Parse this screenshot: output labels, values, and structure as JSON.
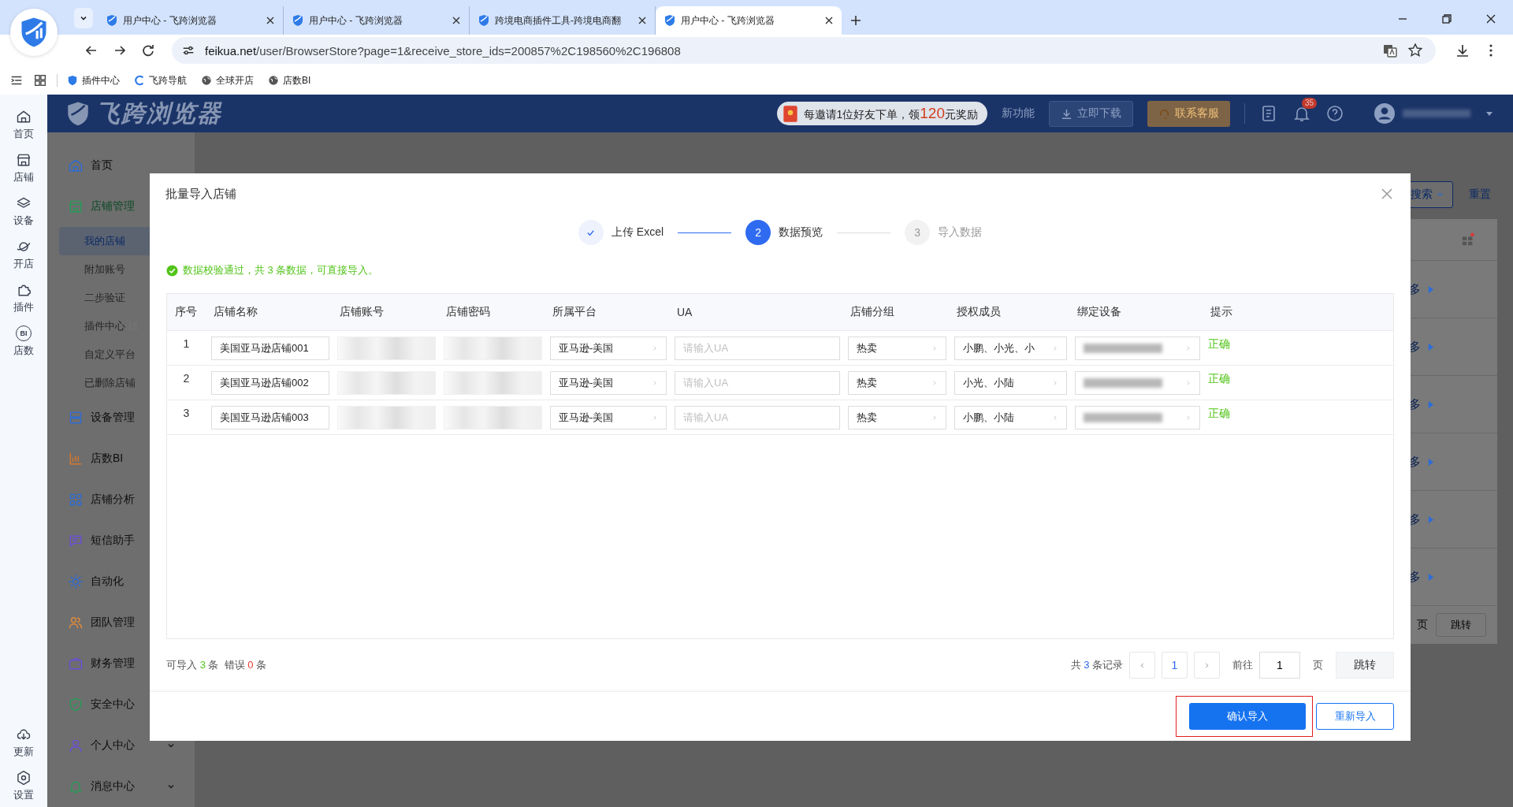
{
  "browser": {
    "tabs": [
      {
        "title": "用户中心 - 飞跨浏览器",
        "selected": false
      },
      {
        "title": "用户中心 - 飞跨浏览器",
        "selected": false
      },
      {
        "title": "跨境电商插件工具-跨境电商翻",
        "selected": false
      },
      {
        "title": "用户中心 - 飞跨浏览器",
        "selected": true
      }
    ],
    "url_host": "feikua.net",
    "url_path": "/user/BrowserStore?page=1&receive_store_ids=200857%2C198560%2C196808",
    "bookmarks": [
      "插件中心",
      "飞跨导航",
      "全球开店",
      "店数BI"
    ]
  },
  "rail": {
    "items": [
      {
        "label": "首页"
      },
      {
        "label": "店铺"
      },
      {
        "label": "设备"
      },
      {
        "label": "开店"
      },
      {
        "label": "插件"
      },
      {
        "label": "店数",
        "icon_text": "BI"
      }
    ],
    "bottom_items": [
      {
        "label": "更新"
      },
      {
        "label": "设置"
      }
    ]
  },
  "header": {
    "logo": "飞跨浏览器",
    "promo_before": "每邀请1位好友下单，领",
    "promo_amount": "120",
    "promo_after": "元奖励",
    "new_features": "新功能",
    "download": "立即下载",
    "support": "联系客服",
    "notification_count": "35"
  },
  "sidebar": {
    "items": [
      {
        "label": "首页",
        "kind": "link",
        "selected": false
      },
      {
        "label": "店铺管理",
        "kind": "group",
        "selected": true,
        "children": [
          {
            "label": "我的店铺",
            "selected": true,
            "external": false
          },
          {
            "label": "附加账号",
            "selected": false,
            "external": false
          },
          {
            "label": "二步验证",
            "selected": false,
            "external": false
          },
          {
            "label": "插件中心",
            "selected": false,
            "external": true
          },
          {
            "label": "自定义平台",
            "selected": false,
            "external": false
          },
          {
            "label": "已删除店铺",
            "selected": false,
            "external": false
          }
        ]
      },
      {
        "label": "设备管理",
        "kind": "link",
        "selected": false
      },
      {
        "label": "店数BI",
        "kind": "link",
        "selected": false
      },
      {
        "label": "店铺分析",
        "kind": "link",
        "selected": false
      },
      {
        "label": "短信助手",
        "kind": "link",
        "selected": false
      },
      {
        "label": "自动化",
        "kind": "link",
        "selected": false
      },
      {
        "label": "团队管理",
        "kind": "link",
        "selected": false
      },
      {
        "label": "财务管理",
        "kind": "link",
        "selected": false
      },
      {
        "label": "安全中心",
        "kind": "link",
        "selected": false
      },
      {
        "label": "个人中心",
        "kind": "group",
        "selected": false
      },
      {
        "label": "消息中心",
        "kind": "group",
        "selected": false
      }
    ]
  },
  "background": {
    "search": "搜索",
    "reset": "重置",
    "more": [
      "多",
      "多",
      "多",
      "多",
      "多",
      "多"
    ],
    "page_unit": "页",
    "jump": "跳转"
  },
  "modal": {
    "title": "批量导入店铺",
    "steps": [
      {
        "label": "上传 Excel",
        "completed": true,
        "selected": false
      },
      {
        "number": "2",
        "label": "数据预览",
        "completed": false,
        "selected": true
      },
      {
        "number": "3",
        "label": "导入数据",
        "completed": false,
        "selected": false
      }
    ],
    "message": "数据校验通过，共 3 条数据，可直接导入。",
    "columns": [
      "序号",
      "店铺名称",
      "店铺账号",
      "店铺密码",
      "所属平台",
      "UA",
      "店铺分组",
      "授权成员",
      "绑定设备",
      "提示"
    ],
    "rows": [
      {
        "index": "1",
        "name": "美国亚马逊店铺001",
        "platform": "亚马逊-美国",
        "ua_placeholder": "请输入UA",
        "group": "热卖",
        "members": "小鹏、小光、小",
        "hint": "正确"
      },
      {
        "index": "2",
        "name": "美国亚马逊店铺002",
        "platform": "亚马逊-美国",
        "ua_placeholder": "请输入UA",
        "group": "热卖",
        "members": "小光、小陆",
        "hint": "正确"
      },
      {
        "index": "3",
        "name": "美国亚马逊店铺003",
        "platform": "亚马逊-美国",
        "ua_placeholder": "请输入UA",
        "group": "热卖",
        "members": "小鹏、小陆",
        "hint": "正确"
      }
    ],
    "summary": {
      "importable_label": "可导入",
      "importable_count": "3",
      "importable_unit": "条",
      "error_label": "错误",
      "error_count": "0",
      "error_unit": "条"
    },
    "pagination": {
      "total_prefix": "共",
      "total": "3",
      "total_suffix": "条记录",
      "pages": [
        {
          "label": "1",
          "selected": true
        }
      ],
      "goto_label": "前往",
      "goto_value": "1",
      "page_unit": "页",
      "jump": "跳转"
    },
    "confirm": "确认导入",
    "reimport": "重新导入"
  }
}
